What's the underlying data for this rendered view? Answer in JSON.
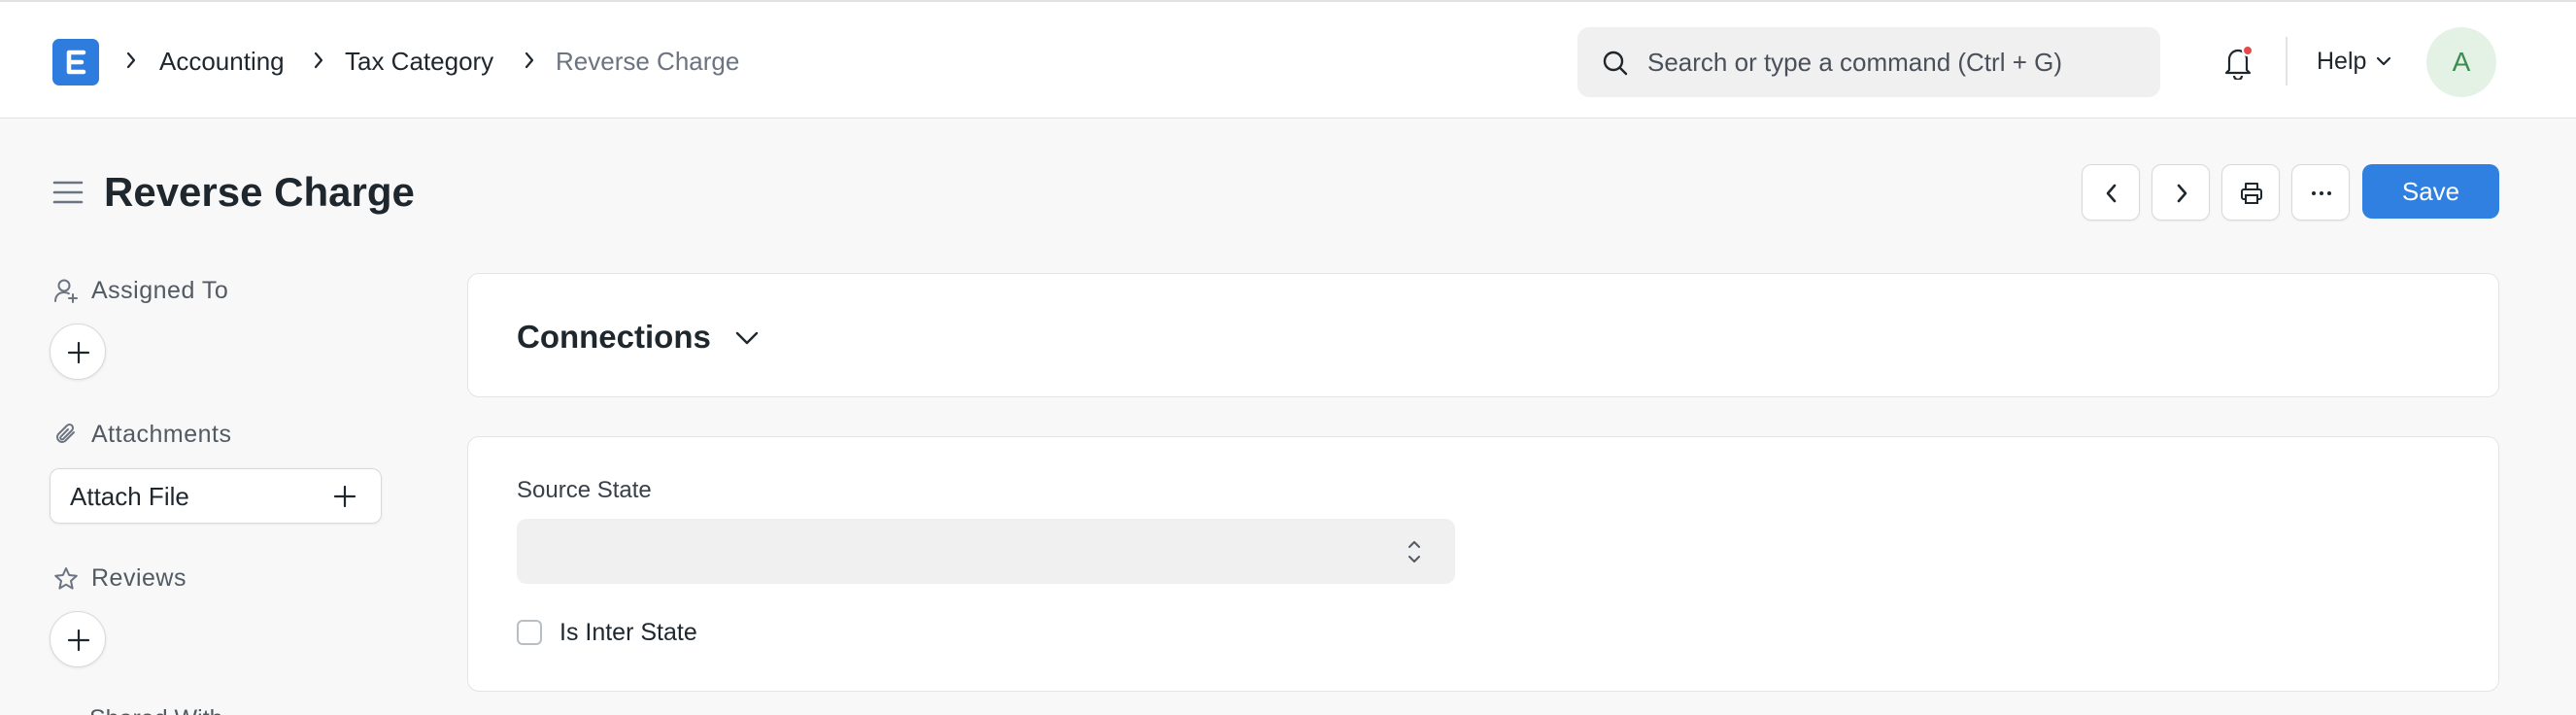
{
  "app": {
    "logo_letter": "E",
    "brand_color": "#2e7dde"
  },
  "breadcrumb": [
    "Accounting",
    "Tax Category",
    "Reverse Charge"
  ],
  "search": {
    "placeholder": "Search or type a command (Ctrl + G)"
  },
  "navbar": {
    "help_label": "Help",
    "avatar_initial": "A"
  },
  "page": {
    "title": "Reverse Charge",
    "save_label": "Save"
  },
  "sidebar": {
    "assigned_to": "Assigned To",
    "attachments": "Attachments",
    "attach_file": "Attach File",
    "reviews": "Reviews",
    "partial_next": "Shared With"
  },
  "connections": {
    "title": "Connections"
  },
  "form": {
    "source_state_label": "Source State",
    "source_state_value": "",
    "is_inter_state_label": "Is Inter State",
    "is_inter_state_checked": false
  },
  "colors": {
    "accent": "#2f80e0",
    "avatar_bg": "#e4f2e6",
    "avatar_fg": "#3e8b4f",
    "notification_dot": "#e24c4c"
  }
}
